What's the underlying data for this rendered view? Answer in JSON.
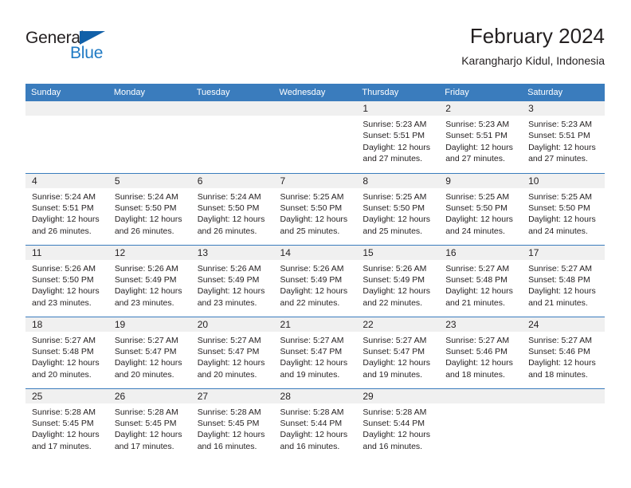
{
  "brand": {
    "name_part1": "General",
    "name_part2": "Blue",
    "triangle_color": "#1160a8",
    "blue_color": "#1f7ac4"
  },
  "header": {
    "title": "February 2024",
    "subtitle": "Karangharjo Kidul, Indonesia"
  },
  "theme": {
    "header_row_bg": "#3a7cbd",
    "daynum_bg": "#f0f0f0",
    "text_color": "#231f20"
  },
  "weekday_headers": [
    "Sunday",
    "Monday",
    "Tuesday",
    "Wednesday",
    "Thursday",
    "Friday",
    "Saturday"
  ],
  "weeks": [
    [
      {
        "day": "",
        "lines": []
      },
      {
        "day": "",
        "lines": []
      },
      {
        "day": "",
        "lines": []
      },
      {
        "day": "",
        "lines": []
      },
      {
        "day": "1",
        "lines": [
          "Sunrise: 5:23 AM",
          "Sunset: 5:51 PM",
          "Daylight: 12 hours",
          "and 27 minutes."
        ]
      },
      {
        "day": "2",
        "lines": [
          "Sunrise: 5:23 AM",
          "Sunset: 5:51 PM",
          "Daylight: 12 hours",
          "and 27 minutes."
        ]
      },
      {
        "day": "3",
        "lines": [
          "Sunrise: 5:23 AM",
          "Sunset: 5:51 PM",
          "Daylight: 12 hours",
          "and 27 minutes."
        ]
      }
    ],
    [
      {
        "day": "4",
        "lines": [
          "Sunrise: 5:24 AM",
          "Sunset: 5:51 PM",
          "Daylight: 12 hours",
          "and 26 minutes."
        ]
      },
      {
        "day": "5",
        "lines": [
          "Sunrise: 5:24 AM",
          "Sunset: 5:50 PM",
          "Daylight: 12 hours",
          "and 26 minutes."
        ]
      },
      {
        "day": "6",
        "lines": [
          "Sunrise: 5:24 AM",
          "Sunset: 5:50 PM",
          "Daylight: 12 hours",
          "and 26 minutes."
        ]
      },
      {
        "day": "7",
        "lines": [
          "Sunrise: 5:25 AM",
          "Sunset: 5:50 PM",
          "Daylight: 12 hours",
          "and 25 minutes."
        ]
      },
      {
        "day": "8",
        "lines": [
          "Sunrise: 5:25 AM",
          "Sunset: 5:50 PM",
          "Daylight: 12 hours",
          "and 25 minutes."
        ]
      },
      {
        "day": "9",
        "lines": [
          "Sunrise: 5:25 AM",
          "Sunset: 5:50 PM",
          "Daylight: 12 hours",
          "and 24 minutes."
        ]
      },
      {
        "day": "10",
        "lines": [
          "Sunrise: 5:25 AM",
          "Sunset: 5:50 PM",
          "Daylight: 12 hours",
          "and 24 minutes."
        ]
      }
    ],
    [
      {
        "day": "11",
        "lines": [
          "Sunrise: 5:26 AM",
          "Sunset: 5:50 PM",
          "Daylight: 12 hours",
          "and 23 minutes."
        ]
      },
      {
        "day": "12",
        "lines": [
          "Sunrise: 5:26 AM",
          "Sunset: 5:49 PM",
          "Daylight: 12 hours",
          "and 23 minutes."
        ]
      },
      {
        "day": "13",
        "lines": [
          "Sunrise: 5:26 AM",
          "Sunset: 5:49 PM",
          "Daylight: 12 hours",
          "and 23 minutes."
        ]
      },
      {
        "day": "14",
        "lines": [
          "Sunrise: 5:26 AM",
          "Sunset: 5:49 PM",
          "Daylight: 12 hours",
          "and 22 minutes."
        ]
      },
      {
        "day": "15",
        "lines": [
          "Sunrise: 5:26 AM",
          "Sunset: 5:49 PM",
          "Daylight: 12 hours",
          "and 22 minutes."
        ]
      },
      {
        "day": "16",
        "lines": [
          "Sunrise: 5:27 AM",
          "Sunset: 5:48 PM",
          "Daylight: 12 hours",
          "and 21 minutes."
        ]
      },
      {
        "day": "17",
        "lines": [
          "Sunrise: 5:27 AM",
          "Sunset: 5:48 PM",
          "Daylight: 12 hours",
          "and 21 minutes."
        ]
      }
    ],
    [
      {
        "day": "18",
        "lines": [
          "Sunrise: 5:27 AM",
          "Sunset: 5:48 PM",
          "Daylight: 12 hours",
          "and 20 minutes."
        ]
      },
      {
        "day": "19",
        "lines": [
          "Sunrise: 5:27 AM",
          "Sunset: 5:47 PM",
          "Daylight: 12 hours",
          "and 20 minutes."
        ]
      },
      {
        "day": "20",
        "lines": [
          "Sunrise: 5:27 AM",
          "Sunset: 5:47 PM",
          "Daylight: 12 hours",
          "and 20 minutes."
        ]
      },
      {
        "day": "21",
        "lines": [
          "Sunrise: 5:27 AM",
          "Sunset: 5:47 PM",
          "Daylight: 12 hours",
          "and 19 minutes."
        ]
      },
      {
        "day": "22",
        "lines": [
          "Sunrise: 5:27 AM",
          "Sunset: 5:47 PM",
          "Daylight: 12 hours",
          "and 19 minutes."
        ]
      },
      {
        "day": "23",
        "lines": [
          "Sunrise: 5:27 AM",
          "Sunset: 5:46 PM",
          "Daylight: 12 hours",
          "and 18 minutes."
        ]
      },
      {
        "day": "24",
        "lines": [
          "Sunrise: 5:27 AM",
          "Sunset: 5:46 PM",
          "Daylight: 12 hours",
          "and 18 minutes."
        ]
      }
    ],
    [
      {
        "day": "25",
        "lines": [
          "Sunrise: 5:28 AM",
          "Sunset: 5:45 PM",
          "Daylight: 12 hours",
          "and 17 minutes."
        ]
      },
      {
        "day": "26",
        "lines": [
          "Sunrise: 5:28 AM",
          "Sunset: 5:45 PM",
          "Daylight: 12 hours",
          "and 17 minutes."
        ]
      },
      {
        "day": "27",
        "lines": [
          "Sunrise: 5:28 AM",
          "Sunset: 5:45 PM",
          "Daylight: 12 hours",
          "and 16 minutes."
        ]
      },
      {
        "day": "28",
        "lines": [
          "Sunrise: 5:28 AM",
          "Sunset: 5:44 PM",
          "Daylight: 12 hours",
          "and 16 minutes."
        ]
      },
      {
        "day": "29",
        "lines": [
          "Sunrise: 5:28 AM",
          "Sunset: 5:44 PM",
          "Daylight: 12 hours",
          "and 16 minutes."
        ]
      },
      {
        "day": "",
        "lines": []
      },
      {
        "day": "",
        "lines": []
      }
    ]
  ]
}
